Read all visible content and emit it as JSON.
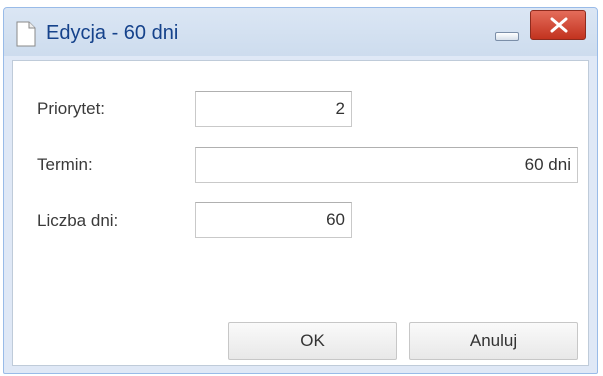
{
  "window": {
    "title": "Edycja - 60 dni",
    "icon": "document-icon",
    "controls": {
      "minimize_icon": "minimize-icon",
      "close_icon": "close-icon",
      "close_color": "#d24a37"
    }
  },
  "form": {
    "priority": {
      "label": "Priorytet:",
      "value": "2"
    },
    "term": {
      "label": "Termin:",
      "value": "60 dni"
    },
    "days": {
      "label": "Liczba dni:",
      "value": "60"
    }
  },
  "buttons": {
    "ok_label": "OK",
    "cancel_label": "Anuluj"
  },
  "colors": {
    "title_text": "#15428b",
    "frame": "#dfe8f6",
    "frame_border": "#99bbe8"
  }
}
